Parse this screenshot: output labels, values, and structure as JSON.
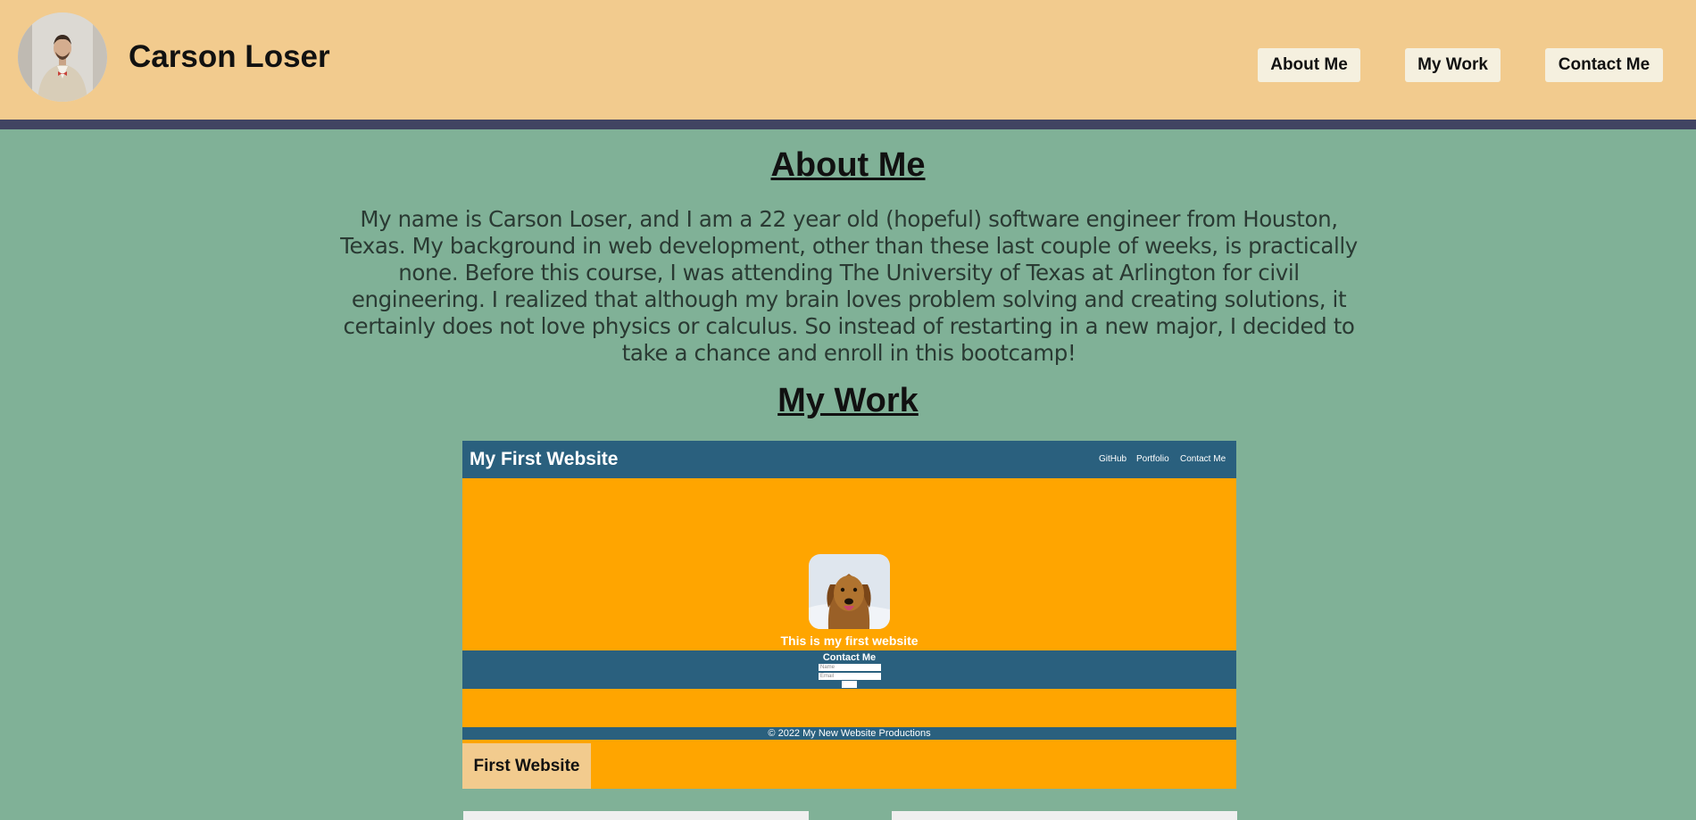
{
  "header": {
    "name": "Carson Loser",
    "nav": [
      "About Me",
      "My Work",
      "Contact Me"
    ]
  },
  "about": {
    "title": "About Me",
    "text": "My name is Carson Loser, and I am a 22 year old (hopeful) software engineer from Houston, Texas. My background in web development, other than these last couple of weeks, is practically none. Before this course, I was attending The University of Texas at Arlington for civil engineering. I realized that although my brain loves problem solving and creating solutions, it certainly does not love physics or calculus. So instead of restarting in a new major, I decided to take a chance and enroll in this bootcamp!"
  },
  "work": {
    "title": "My Work",
    "projects": [
      {
        "label": "First Website",
        "preview": {
          "title": "My First Website",
          "nav": [
            "GitHub",
            "Portfolio",
            "Contact Me"
          ],
          "caption": "This is my first website",
          "contact_title": "Contact Me",
          "name_placeholder": "Name",
          "email_placeholder": "Email",
          "footer": "© 2022 My New Website Productions"
        }
      }
    ]
  },
  "colors": {
    "background": "#80b197",
    "header": "#f2cb8e",
    "header_bar": "#414462",
    "nav_button": "#f5f0df",
    "preview_orange": "#ffa500",
    "preview_blue": "#2a607e"
  }
}
